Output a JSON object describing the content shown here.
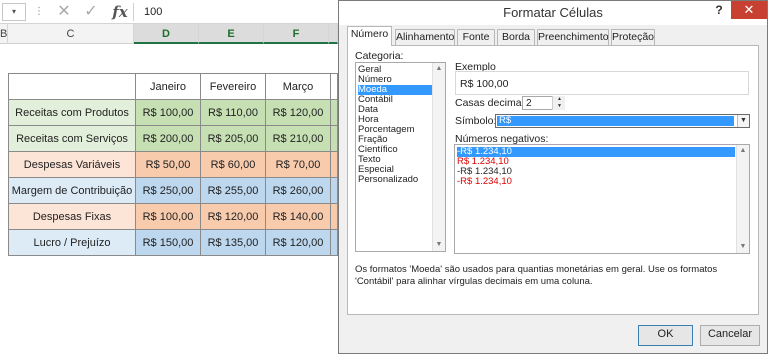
{
  "excel": {
    "formula_bar": {
      "name_arrow": "▾",
      "dots": "⋮",
      "cancel": "✕",
      "enter": "✓",
      "fx": "fx",
      "value": "100"
    },
    "columns": [
      "B",
      "C",
      "D",
      "E",
      "F"
    ],
    "header_row": [
      "Janeiro",
      "Fevereiro",
      "Março"
    ],
    "rows": [
      {
        "label": "Receitas com Produtos",
        "values": [
          "R$ 100,00",
          "R$ 110,00",
          "R$ 120,00"
        ]
      },
      {
        "label": "Receitas com Serviços",
        "values": [
          "R$ 200,00",
          "R$ 205,00",
          "R$ 210,00"
        ]
      },
      {
        "label": "Despesas Variáveis",
        "values": [
          "R$ 50,00",
          "R$ 60,00",
          "R$ 70,00"
        ]
      },
      {
        "label": "Margem de Contribuição",
        "values": [
          "R$ 250,00",
          "R$ 255,00",
          "R$ 260,00"
        ]
      },
      {
        "label": "Despesas Fixas",
        "values": [
          "R$ 100,00",
          "R$ 120,00",
          "R$ 140,00"
        ]
      },
      {
        "label": "Lucro / Prejuízo",
        "values": [
          "R$ 150,00",
          "R$ 135,00",
          "R$ 120,00"
        ]
      }
    ],
    "colors": {
      "label_fills": [
        "#e2efda",
        "#e2efda",
        "#fce4d6",
        "#ddebf7",
        "#fce4d6",
        "#ddebf7"
      ],
      "value_fills": [
        "#c6e0b4",
        "#c6e0b4",
        "#f8cbad",
        "#bdd7ee",
        "#f8cbad",
        "#bdd7ee"
      ],
      "selected_column_accent": "#217346"
    }
  },
  "dialog": {
    "title": "Formatar Células",
    "help": "?",
    "close": "✕",
    "tabs": [
      "Número",
      "Alinhamento",
      "Fonte",
      "Borda",
      "Preenchimento",
      "Proteção"
    ],
    "active_tab": "Número",
    "categoria_label": "Categoria:",
    "categories": [
      "Geral",
      "Número",
      "Moeda",
      "Contábil",
      "Data",
      "Hora",
      "Porcentagem",
      "Fração",
      "Científico",
      "Texto",
      "Especial",
      "Personalizado"
    ],
    "selected_category": "Moeda",
    "exemplo_label": "Exemplo",
    "exemplo_value": "R$ 100,00",
    "casas_label": "Casas decimais:",
    "casas_value": "2",
    "simbolo_label": "Símbolo:",
    "simbolo_value": "R$",
    "negativos_label": "Números negativos:",
    "negatives": [
      {
        "text": "-R$ 1.234,10",
        "selected": true,
        "red": false
      },
      {
        "text": "R$ 1.234,10",
        "selected": false,
        "red": true
      },
      {
        "text": "-R$ 1.234,10",
        "selected": false,
        "red": false
      },
      {
        "text": "-R$ 1.234,10",
        "selected": false,
        "red": true
      }
    ],
    "description": "Os formatos 'Moeda' são usados para quantias monetárias em geral. Use os formatos 'Contábil' para alinhar vírgulas decimais em uma coluna.",
    "ok_label": "OK",
    "cancel_label": "Cancelar",
    "colors": {
      "selection": "#3399ff",
      "negative_red": "#e00000",
      "close_button": "#c84031"
    }
  }
}
